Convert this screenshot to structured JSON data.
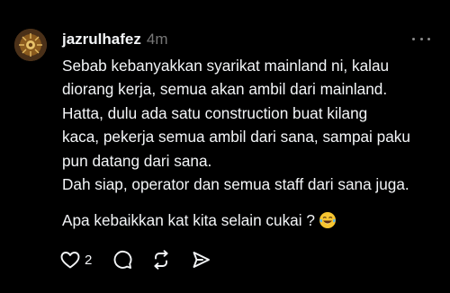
{
  "post": {
    "username": "jazrulhafez",
    "time": "4m",
    "avatar_icon": "avatar-image",
    "body_lines": [
      "Sebab kebanyakkan syarikat mainland ni, kalau",
      "diorang kerja, semua akan ambil dari mainland.",
      "Hatta, dulu ada satu construction buat kilang",
      "kaca, pekerja semua ambil dari sana, sampai paku",
      "pun datang dari sana.",
      "Dah siap, operator dan semua staff dari sana juga."
    ],
    "question": "Apa kebaikkan kat kita selain cukai ?",
    "emoji": "laughing-tears-emoji",
    "actions": {
      "like_count": "2",
      "like_icon": "heart-icon",
      "reply_icon": "comment-icon",
      "repost_icon": "repost-icon",
      "share_icon": "send-icon"
    }
  },
  "colors": {
    "background": "#000000",
    "text": "#f3f5f7",
    "muted": "#777777"
  }
}
